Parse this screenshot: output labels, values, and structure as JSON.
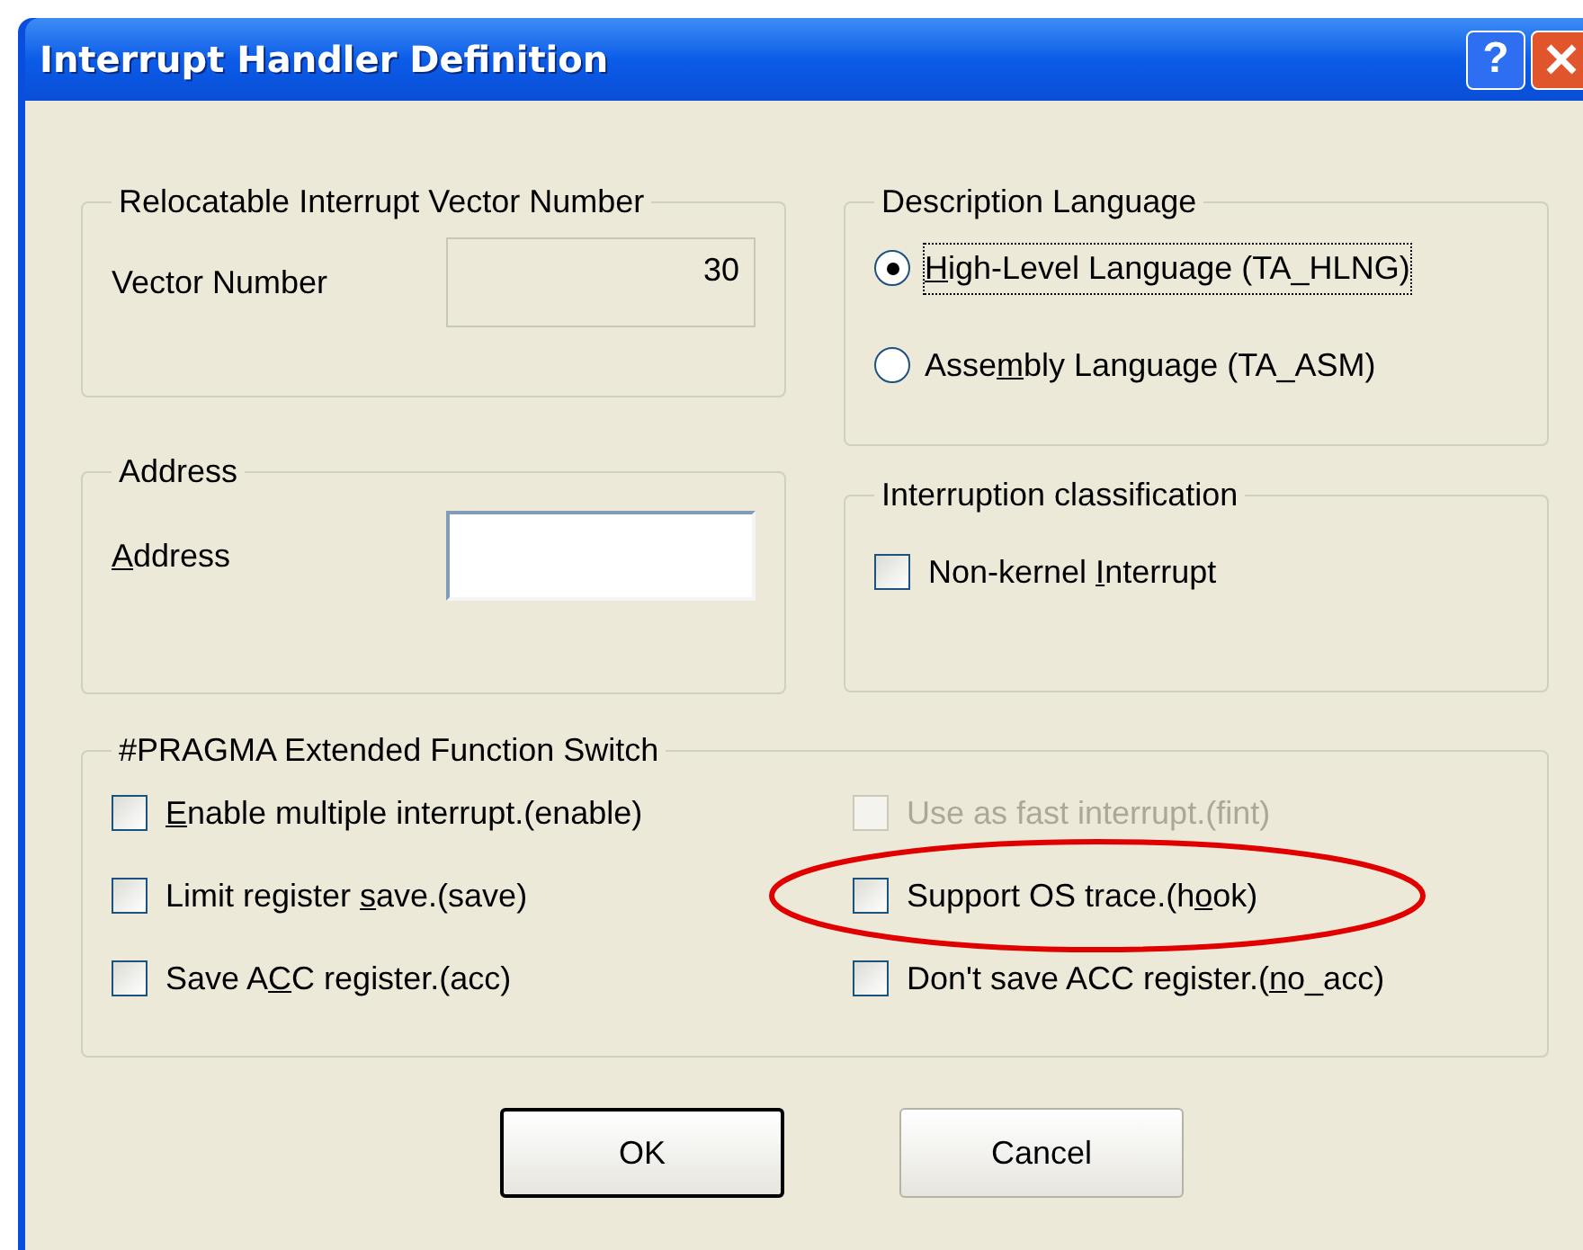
{
  "window": {
    "title": "Interrupt Handler Definition",
    "help_button": "?"
  },
  "vector_group": {
    "title": "Relocatable Interrupt Vector Number",
    "label": {
      "pre": "Vector Number"
    },
    "value": "30"
  },
  "address_group": {
    "title": "Address",
    "label": {
      "key": "A",
      "post": "ddress"
    }
  },
  "language_group": {
    "title": "Description Language",
    "options": [
      {
        "label": {
          "key": "H",
          "post": "igh-Level Language (TA_HLNG)"
        },
        "selected": true
      },
      {
        "label": {
          "pre": "Asse",
          "key": "m",
          "post": "bly Language (TA_ASM)"
        },
        "selected": false
      }
    ]
  },
  "classification_group": {
    "title": "Interruption classification",
    "options": [
      {
        "label": {
          "pre": "Non-kernel ",
          "key": "I",
          "post": "nterrupt"
        },
        "checked": false,
        "disabled": false,
        "circled": false
      }
    ]
  },
  "pragma_group": {
    "title": "#PRAGMA Extended Function Switch",
    "options": [
      {
        "label": {
          "key": "E",
          "post": "nable multiple interrupt.(enable)"
        },
        "checked": false,
        "disabled": false,
        "circled": false
      },
      {
        "label": {
          "pre": "Use as fast interrupt.(fint)"
        },
        "checked": false,
        "disabled": true,
        "circled": false
      },
      {
        "label": {
          "pre": "Limit register ",
          "key": "s",
          "post": "ave.(save)"
        },
        "checked": false,
        "disabled": false,
        "circled": false
      },
      {
        "label": {
          "pre": "Support OS trace.(h",
          "key": "o",
          "post": "ok)"
        },
        "checked": false,
        "disabled": false,
        "circled": true
      },
      {
        "label": {
          "pre": "Save A",
          "key": "C",
          "post": "C register.(acc)"
        },
        "checked": false,
        "disabled": false,
        "circled": false
      },
      {
        "label": {
          "pre": "Don't save ACC register.(",
          "key": "n",
          "post": "o_acc)"
        },
        "checked": false,
        "disabled": false,
        "circled": false
      }
    ]
  },
  "buttons": [
    {
      "label": "OK",
      "default": true
    },
    {
      "label": "Cancel",
      "default": false
    }
  ]
}
